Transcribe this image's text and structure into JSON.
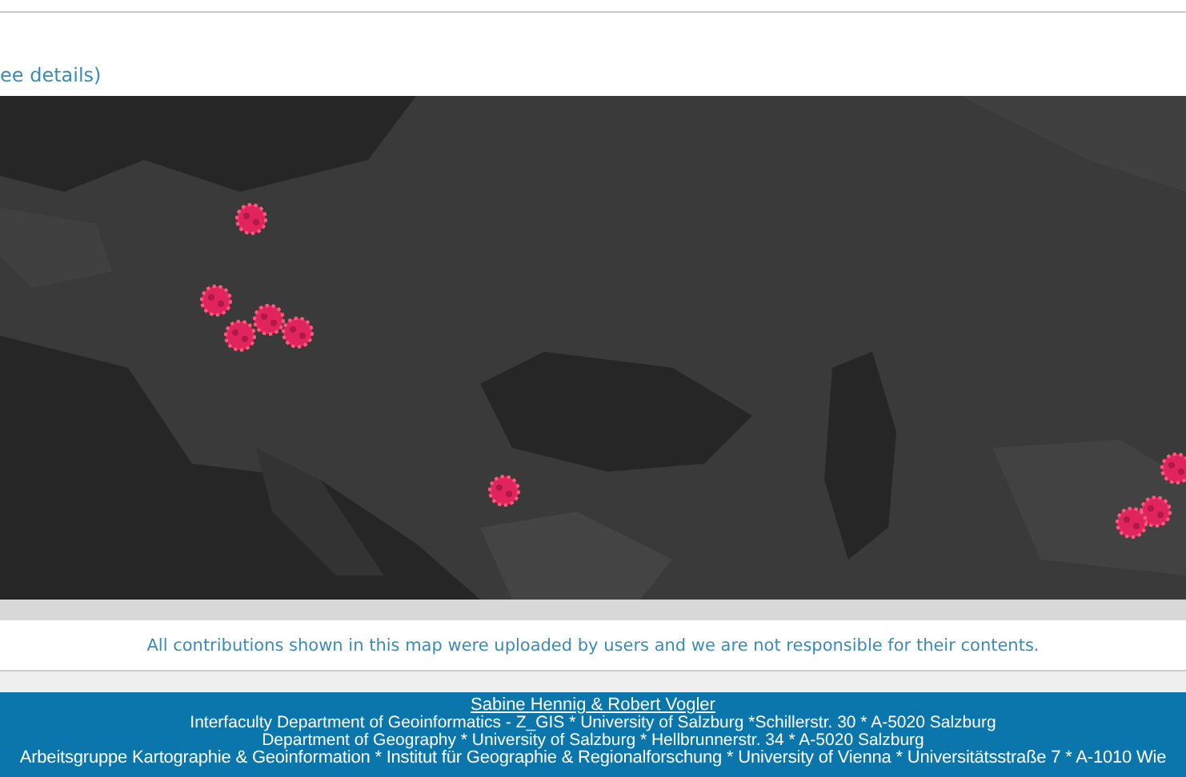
{
  "header": {
    "link_text": "ee details)"
  },
  "notice": "All contributions shown in this map were uploaded by users and we are not responsible for their contents.",
  "footer": {
    "authors": "Sabine Hennig & Robert Vogler",
    "lines": [
      "Interfaculty Department of Geoinformatics - Z_GIS * University of Salzburg *Schillerstr. 30 * A-5020 Salzburg",
      "Department of Geography * University of Salzburg * Hellbrunnerstr. 34 * A-5020 Salzburg",
      "Arbeitsgruppe Kartographie & Geoinformation * Institut für Geographie & Regionalforschung * University of Vienna * Universitätsstraße 7 * A-1010 Wie"
    ]
  }
}
